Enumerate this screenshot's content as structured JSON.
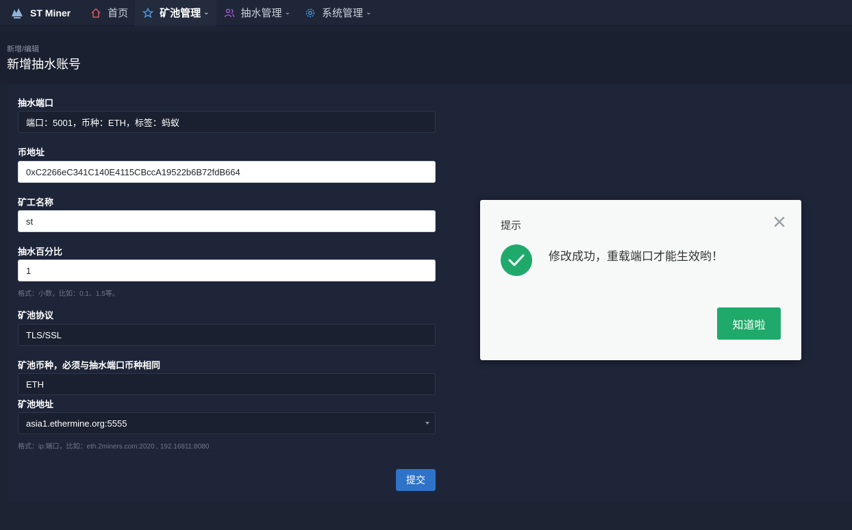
{
  "nav": {
    "brand": "ST Miner",
    "items": [
      {
        "label": "首页",
        "icon": "home-icon",
        "color": "#e05a5a"
      },
      {
        "label": "矿池管理",
        "icon": "star-icon",
        "color": "#4ea3f0"
      },
      {
        "label": "抽水管理",
        "icon": "users-icon",
        "color": "#b45ee0"
      },
      {
        "label": "系统管理",
        "icon": "gear-icon",
        "color": "#4ea3f0"
      }
    ]
  },
  "header": {
    "breadcrumb": "新增/编辑",
    "title": "新增抽水账号"
  },
  "form": {
    "port": {
      "label": "抽水端口",
      "value": "端口：5001，币种：ETH，标签：蚂蚁"
    },
    "address": {
      "label": "币地址",
      "value": "0xC2266eC341C140E4115CBccA19522b6B72fdB664"
    },
    "worker": {
      "label": "矿工名称",
      "value": "st"
    },
    "percent": {
      "label": "抽水百分比",
      "value": "1",
      "hint": "格式：小数，比如：0.1、1.5等。"
    },
    "protocol": {
      "label": "矿池协议",
      "value": "TLS/SSL"
    },
    "coin": {
      "label": "矿池币种，必须与抽水端口币种相同",
      "value": "ETH"
    },
    "pool": {
      "label": "矿池地址",
      "value": "asia1.ethermine.org:5555",
      "hint": "格式：ip:端口，比如：eth.2miners.com:2020 , 192.16811:8080"
    },
    "submit_label": "提交"
  },
  "dialog": {
    "title": "提示",
    "message": "修改成功，重载端口才能生效哟！",
    "button_label": "知道啦",
    "accent": "#1faa6b"
  }
}
